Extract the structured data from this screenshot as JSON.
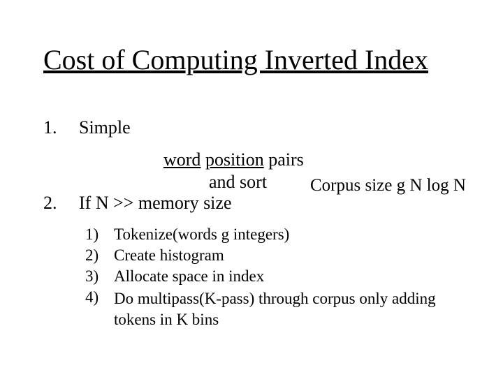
{
  "title": "Cost of Computing Inverted Index",
  "items": {
    "one": {
      "num": "1.",
      "text": "Simple"
    },
    "two": {
      "num": "2.",
      "text": "If N >> memory size"
    }
  },
  "mid": {
    "word": "word",
    "position": "position",
    "pairs": " pairs",
    "and_sort": "and sort",
    "corpus": "Corpus size g N log N"
  },
  "arrow_glyph": "g",
  "sub": {
    "s1": {
      "num": "1)",
      "text_a": "Tokenize(words ",
      "text_b": " integers)"
    },
    "s2": {
      "num": "2)",
      "text": "Create histogram"
    },
    "s3": {
      "num": "3)",
      "text": "Allocate space in index"
    },
    "s4": {
      "num": "4)",
      "text": "Do multipass(K-pass) through corpus only adding tokens in K bins"
    }
  }
}
